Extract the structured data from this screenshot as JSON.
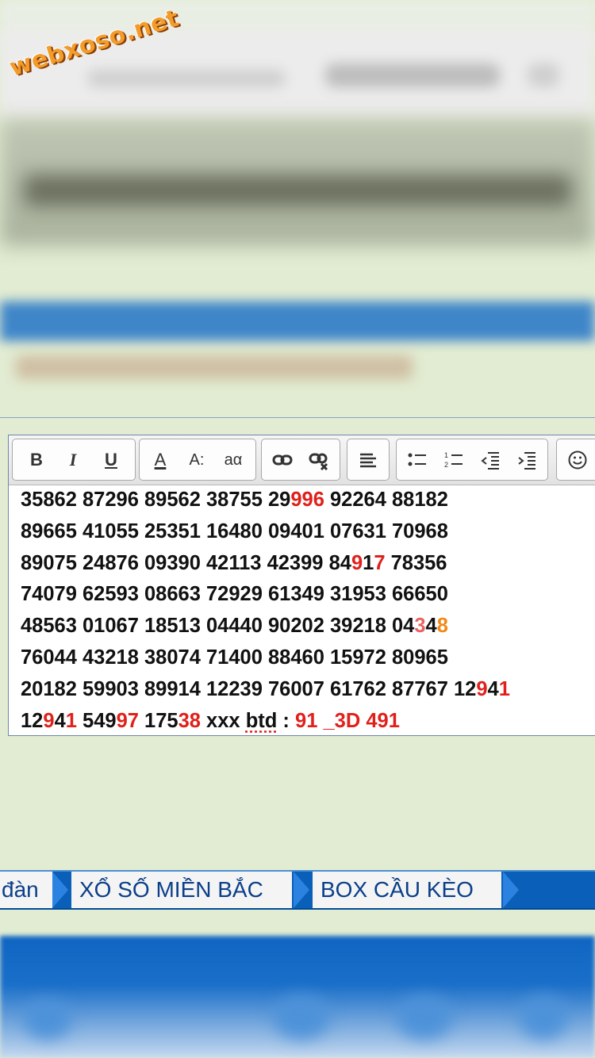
{
  "watermark": "webxoso.net",
  "toolbar": {
    "bold": "B",
    "italic": "I",
    "underline": "U",
    "font_color": "A",
    "font_size": "A:",
    "font_style": "aα"
  },
  "content_lines": [
    [
      {
        "t": "35862 87296 89562 38755 29"
      },
      {
        "t": "99",
        "c": "red"
      },
      {
        "t": "6",
        "c": "red"
      },
      {
        "t": " 92264  88182"
      }
    ],
    [
      {
        "t": "89665 41055 25351 16480 09401 07631 70968"
      }
    ],
    [
      {
        "t": "89075 24876 09390 42113 42399 84"
      },
      {
        "t": "9",
        "c": "red"
      },
      {
        "t": "1"
      },
      {
        "t": "7",
        "c": "red"
      },
      {
        "t": " 78356"
      }
    ],
    [
      {
        "t": "74079 62593 08663 72929 61349 31953 66650"
      }
    ],
    [
      {
        "t": "48563 01067 18513 04440 90202 39218 04"
      },
      {
        "t": "3",
        "c": "pink"
      },
      {
        "t": "4"
      },
      {
        "t": "8",
        "c": "orange"
      }
    ],
    [
      {
        "t": "76044 43218 38074 71400 88460 15972 80965"
      }
    ],
    [
      {
        "t": "20182 59903 89914 12239 76007 61762 87767 12"
      },
      {
        "t": "9",
        "c": "red"
      },
      {
        "t": "4"
      },
      {
        "t": "1",
        "c": "red"
      }
    ],
    [
      {
        "t": "12"
      },
      {
        "t": "9",
        "c": "red"
      },
      {
        "t": "4"
      },
      {
        "t": "1",
        "c": "red"
      },
      {
        "t": " 549"
      },
      {
        "t": "97",
        "c": "red"
      },
      {
        "t": " 175"
      },
      {
        "t": "38",
        "c": "red"
      },
      {
        "t": " xxx "
      },
      {
        "t": "btd",
        "u": true
      },
      {
        "t": " : "
      },
      {
        "t": "91 _3D 491",
        "c": "red"
      }
    ]
  ],
  "bottom_nav": {
    "item1": "đàn",
    "item2": "XỔ SỐ MIỀN BẮC",
    "item3": "BOX CẦU KÈO"
  }
}
